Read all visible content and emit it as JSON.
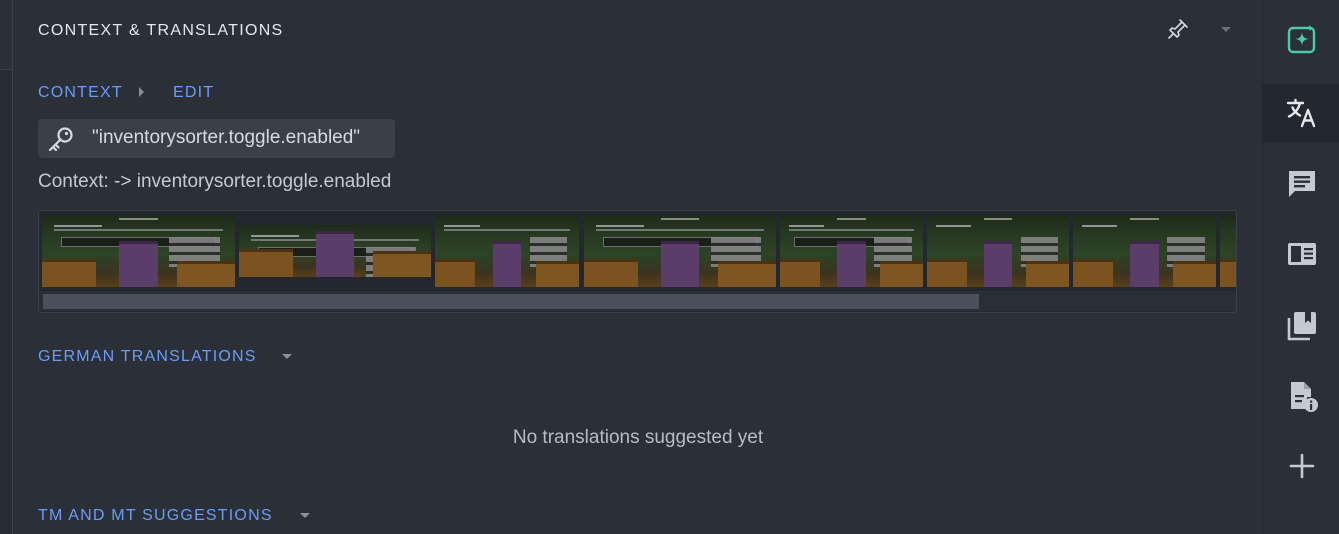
{
  "header": {
    "title": "CONTEXT & TRANSLATIONS"
  },
  "context": {
    "label": "CONTEXT",
    "edit_label": "EDIT",
    "key": "\"inventorysorter.toggle.enabled\"",
    "context_text": "Context: -> inventorysorter.toggle.enabled",
    "screenshot_count": 8
  },
  "translations": {
    "label": "GERMAN TRANSLATIONS",
    "empty_message": "No translations suggested yet"
  },
  "suggestions": {
    "label": "TM AND MT SUGGESTIONS"
  },
  "colors": {
    "accent": "#6e9cf7",
    "ai_icon": "#4ec9b0",
    "background": "#2b2f38"
  },
  "rail": {
    "items": [
      {
        "icon": "ai-assistant-icon",
        "active": false
      },
      {
        "icon": "translate-icon",
        "active": true
      },
      {
        "icon": "comments-icon",
        "active": false
      },
      {
        "icon": "glossary-icon",
        "active": false
      },
      {
        "icon": "library-icon",
        "active": false
      },
      {
        "icon": "file-info-icon",
        "active": false
      },
      {
        "icon": "add-icon",
        "active": false
      }
    ]
  }
}
